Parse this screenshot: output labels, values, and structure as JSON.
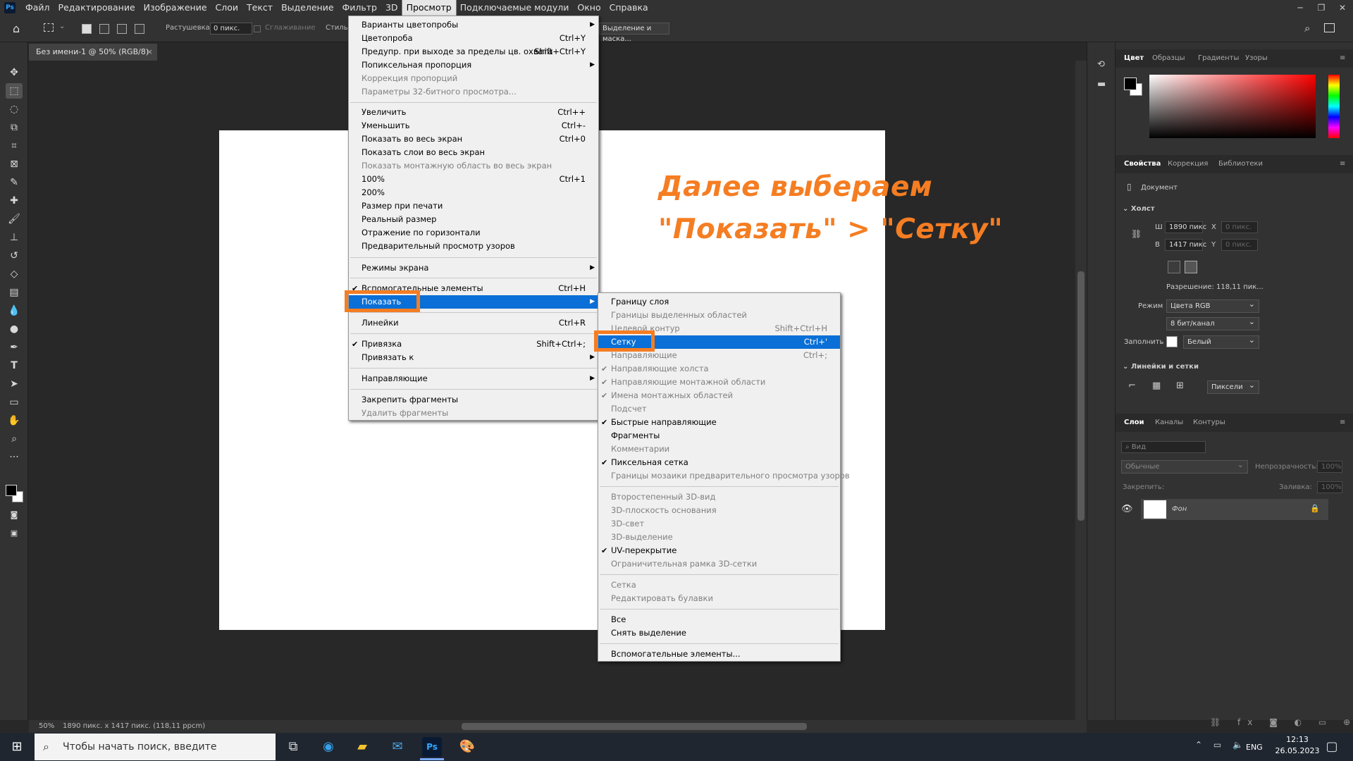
{
  "menubar": {
    "logo": "Ps",
    "items": [
      "Файл",
      "Редактирование",
      "Изображение",
      "Слои",
      "Текст",
      "Выделение",
      "Фильтр",
      "3D",
      "Просмотр",
      "Подключаемые модули",
      "Окно",
      "Справка"
    ],
    "active_index": 8
  },
  "options_bar": {
    "feather_label": "Растушевка:",
    "feather_value": "0 пикс.",
    "antialias_label": "Сглаживание",
    "style_label": "Стиль:",
    "select_mask_button": "Выделение и маска..."
  },
  "document": {
    "tab_title": "Без имени-1 @ 50% (RGB/8)",
    "close": "×"
  },
  "statusbar": {
    "zoom": "50%",
    "info": "1890 пикс. x 1417 пикс. (118,11 ppcm)"
  },
  "annotation": {
    "line1": "Далее выбераем",
    "line2": "\"Показать\" > \"Сетку\""
  },
  "view_menu": {
    "items": [
      {
        "label": "Варианты цветопробы",
        "shortcut": "",
        "arrow": true,
        "disabled": false
      },
      {
        "label": "Цветопроба",
        "shortcut": "Ctrl+Y",
        "disabled": false
      },
      {
        "label": "Предупр. при выходе за пределы цв. охвата",
        "shortcut": "Shift+Ctrl+Y",
        "disabled": false
      },
      {
        "label": "Попиксельная пропорция",
        "shortcut": "",
        "arrow": true,
        "disabled": false
      },
      {
        "label": "Коррекция пропорций",
        "shortcut": "",
        "disabled": true
      },
      {
        "label": "Параметры 32-битного просмотра...",
        "shortcut": "",
        "disabled": true
      },
      {
        "label": "Увеличить",
        "shortcut": "Ctrl++",
        "disabled": false
      },
      {
        "label": "Уменьшить",
        "shortcut": "Ctrl+-",
        "disabled": false
      },
      {
        "label": "Показать во весь экран",
        "shortcut": "Ctrl+0",
        "disabled": false
      },
      {
        "label": "Показать слои во весь экран",
        "shortcut": "",
        "disabled": false
      },
      {
        "label": "Показать монтажную область во весь экран",
        "shortcut": "",
        "disabled": true
      },
      {
        "label": "100%",
        "shortcut": "Ctrl+1",
        "disabled": false
      },
      {
        "label": "200%",
        "shortcut": "",
        "disabled": false
      },
      {
        "label": "Размер при печати",
        "shortcut": "",
        "disabled": false
      },
      {
        "label": "Реальный размер",
        "shortcut": "",
        "disabled": false
      },
      {
        "label": "Отражение по горизонтали",
        "shortcut": "",
        "disabled": false
      },
      {
        "label": "Предварительный просмотр узоров",
        "shortcut": "",
        "disabled": false
      },
      {
        "label": "Режимы экрана",
        "shortcut": "",
        "arrow": true,
        "disabled": false
      },
      {
        "label": "Вспомогательные элементы",
        "shortcut": "Ctrl+H",
        "check": true,
        "disabled": false
      },
      {
        "label": "Показать",
        "shortcut": "",
        "arrow": true,
        "highlight": true,
        "disabled": false
      },
      {
        "label": "Линейки",
        "shortcut": "Ctrl+R",
        "disabled": false
      },
      {
        "label": "Привязка",
        "shortcut": "Shift+Ctrl+;",
        "check": true,
        "disabled": false
      },
      {
        "label": "Привязать к",
        "shortcut": "",
        "arrow": true,
        "disabled": false
      },
      {
        "label": "Направляющие",
        "shortcut": "",
        "arrow": true,
        "disabled": false
      },
      {
        "label": "Закрепить фрагменты",
        "shortcut": "",
        "disabled": false
      },
      {
        "label": "Удалить фрагменты",
        "shortcut": "",
        "disabled": true
      }
    ]
  },
  "show_submenu": {
    "items": [
      {
        "label": "Границу слоя",
        "shortcut": "",
        "disabled": false
      },
      {
        "label": "Границы выделенных областей",
        "shortcut": "",
        "disabled": true
      },
      {
        "label": "Целевой контур",
        "shortcut": "Shift+Ctrl+H",
        "disabled": true
      },
      {
        "label": "Сетку",
        "shortcut": "Ctrl+'",
        "highlight": true,
        "disabled": false
      },
      {
        "label": "Направляющие",
        "shortcut": "Ctrl+;",
        "disabled": true
      },
      {
        "label": "Направляющие холста",
        "shortcut": "",
        "check": true,
        "disabled": true
      },
      {
        "label": "Направляющие монтажной области",
        "shortcut": "",
        "check": true,
        "disabled": true
      },
      {
        "label": "Имена монтажных областей",
        "shortcut": "",
        "check": true,
        "disabled": true
      },
      {
        "label": "Подсчет",
        "shortcut": "",
        "disabled": true
      },
      {
        "label": "Быстрые направляющие",
        "shortcut": "",
        "check": true,
        "disabled": false
      },
      {
        "label": "Фрагменты",
        "shortcut": "",
        "disabled": false
      },
      {
        "label": "Комментарии",
        "shortcut": "",
        "disabled": true
      },
      {
        "label": "Пиксельная сетка",
        "shortcut": "",
        "check": true,
        "disabled": false
      },
      {
        "label": "Границы мозаики предварительного просмотра узоров",
        "shortcut": "",
        "disabled": true
      },
      {
        "label": "Второстепенный 3D-вид",
        "shortcut": "",
        "disabled": true
      },
      {
        "label": "3D-плоскость основания",
        "shortcut": "",
        "disabled": true
      },
      {
        "label": "3D-свет",
        "shortcut": "",
        "disabled": true
      },
      {
        "label": "3D-выделение",
        "shortcut": "",
        "disabled": true
      },
      {
        "label": "UV-перекрытие",
        "shortcut": "",
        "check": true,
        "disabled": false
      },
      {
        "label": "Ограничительная рамка 3D-сетки",
        "shortcut": "",
        "disabled": true
      },
      {
        "label": "Сетка",
        "shortcut": "",
        "disabled": true
      },
      {
        "label": "Редактировать булавки",
        "shortcut": "",
        "disabled": true
      },
      {
        "label": "Все",
        "shortcut": "",
        "disabled": false
      },
      {
        "label": "Снять выделение",
        "shortcut": "",
        "disabled": false
      },
      {
        "label": "Вспомогательные элементы...",
        "shortcut": "",
        "disabled": false
      }
    ]
  },
  "color_panel": {
    "tabs": [
      "Цвет",
      "Образцы",
      "Градиенты",
      "Узоры"
    ]
  },
  "properties_panel": {
    "tabs": [
      "Свойства",
      "Коррекция",
      "Библиотеки"
    ],
    "doc_label": "Документ",
    "canvas_section": "Холст",
    "w_label": "Ш",
    "w_value": "1890 пикс",
    "h_label": "В",
    "h_value": "1417 пикс",
    "x_label": "X",
    "x_value": "0 пикс.",
    "y_label": "Y",
    "y_value": "0 пикс.",
    "resolution": "Разрешение: 118,11 пик...",
    "mode_label": "Режим",
    "mode_value": "Цвета RGB",
    "depth_value": "8 бит/канал",
    "fill_label": "Заполнить",
    "fill_value": "Белый",
    "rulers_section": "Линейки и сетки",
    "units_value": "Пиксели"
  },
  "layers_panel": {
    "tabs": [
      "Слои",
      "Каналы",
      "Контуры"
    ],
    "filter_placeholder": "Вид",
    "blend_mode": "Обычные",
    "opacity_label": "Непрозрачность:",
    "opacity_value": "100%",
    "lock_label": "Закрепить:",
    "fill_label": "Заливка:",
    "fill_value": "100%",
    "layer_name": "Фон"
  },
  "taskbar": {
    "search_placeholder": "Чтобы начать поиск, введите",
    "lang": "ENG",
    "time": "12:13",
    "date": "26.05.2023"
  },
  "colors": {
    "accent_orange": "#f57d22",
    "menu_highlight": "#0a6fd6"
  }
}
